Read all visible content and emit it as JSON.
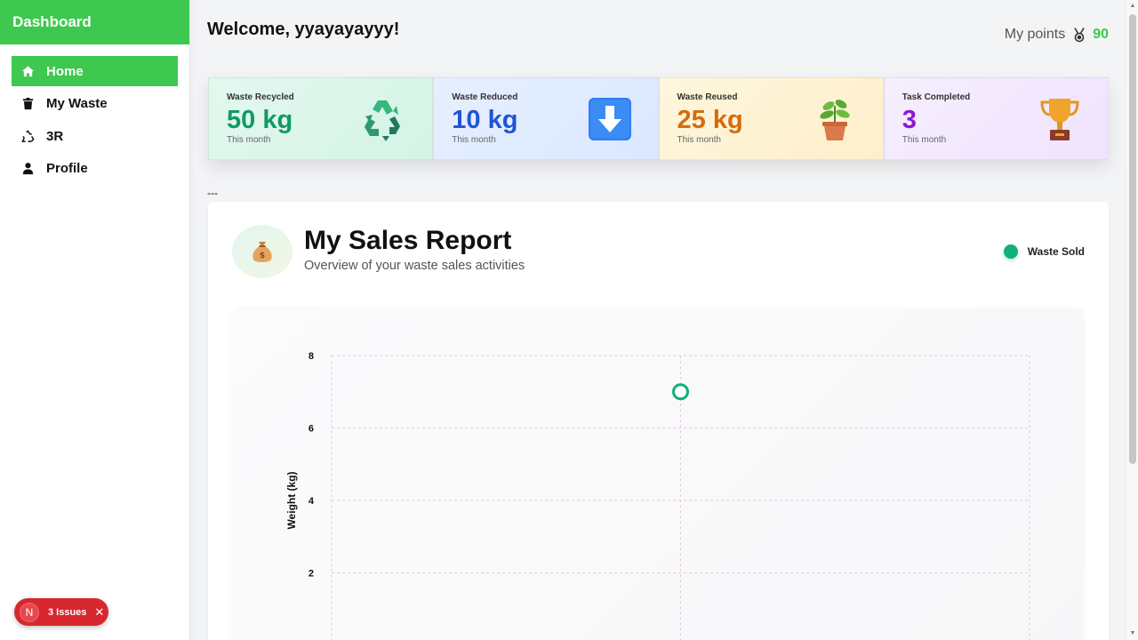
{
  "sidebar": {
    "title": "Dashboard",
    "items": [
      {
        "label": "Home",
        "icon": "home-icon",
        "active": true
      },
      {
        "label": "My Waste",
        "icon": "trash-icon",
        "active": false
      },
      {
        "label": "3R",
        "icon": "recycle-icon",
        "active": false
      },
      {
        "label": "Profile",
        "icon": "user-icon",
        "active": false
      }
    ]
  },
  "header": {
    "welcome": "Welcome, yyayayayyy!",
    "points_label": "My points",
    "points_icon": "medal-icon",
    "points_value": "90"
  },
  "stats": [
    {
      "label": "Waste Recycled",
      "value": "50 kg",
      "sub": "This month",
      "icon": "recycle-icon",
      "color": "#129a63"
    },
    {
      "label": "Waste Reduced",
      "value": "10 kg",
      "sub": "This month",
      "icon": "arrow-down-icon",
      "color": "#1e55d6"
    },
    {
      "label": "Waste Reused",
      "value": "25 kg",
      "sub": "This month",
      "icon": "potted-plant-icon",
      "color": "#d66b0c"
    },
    {
      "label": "Task Completed",
      "value": "3",
      "sub": "This month",
      "icon": "trophy-icon",
      "color": "#8a17d6"
    }
  ],
  "separator": "---",
  "report": {
    "title": "My Sales Report",
    "subtitle": "Overview of your waste sales activities",
    "icon": "money-bag-icon",
    "legend": "Waste Sold"
  },
  "chart_data": {
    "type": "scatter",
    "ylabel": "Weight (kg)",
    "yticks": [
      8,
      6,
      4,
      2
    ],
    "ylim": [
      0,
      8
    ],
    "grid": true,
    "series": [
      {
        "name": "Waste Sold",
        "color": "#10b07d",
        "points": [
          {
            "x": 0.5,
            "y": 7
          }
        ]
      }
    ],
    "xlim": [
      0,
      1
    ]
  },
  "issues_badge": {
    "letter": "N",
    "label": "3 Issues"
  }
}
